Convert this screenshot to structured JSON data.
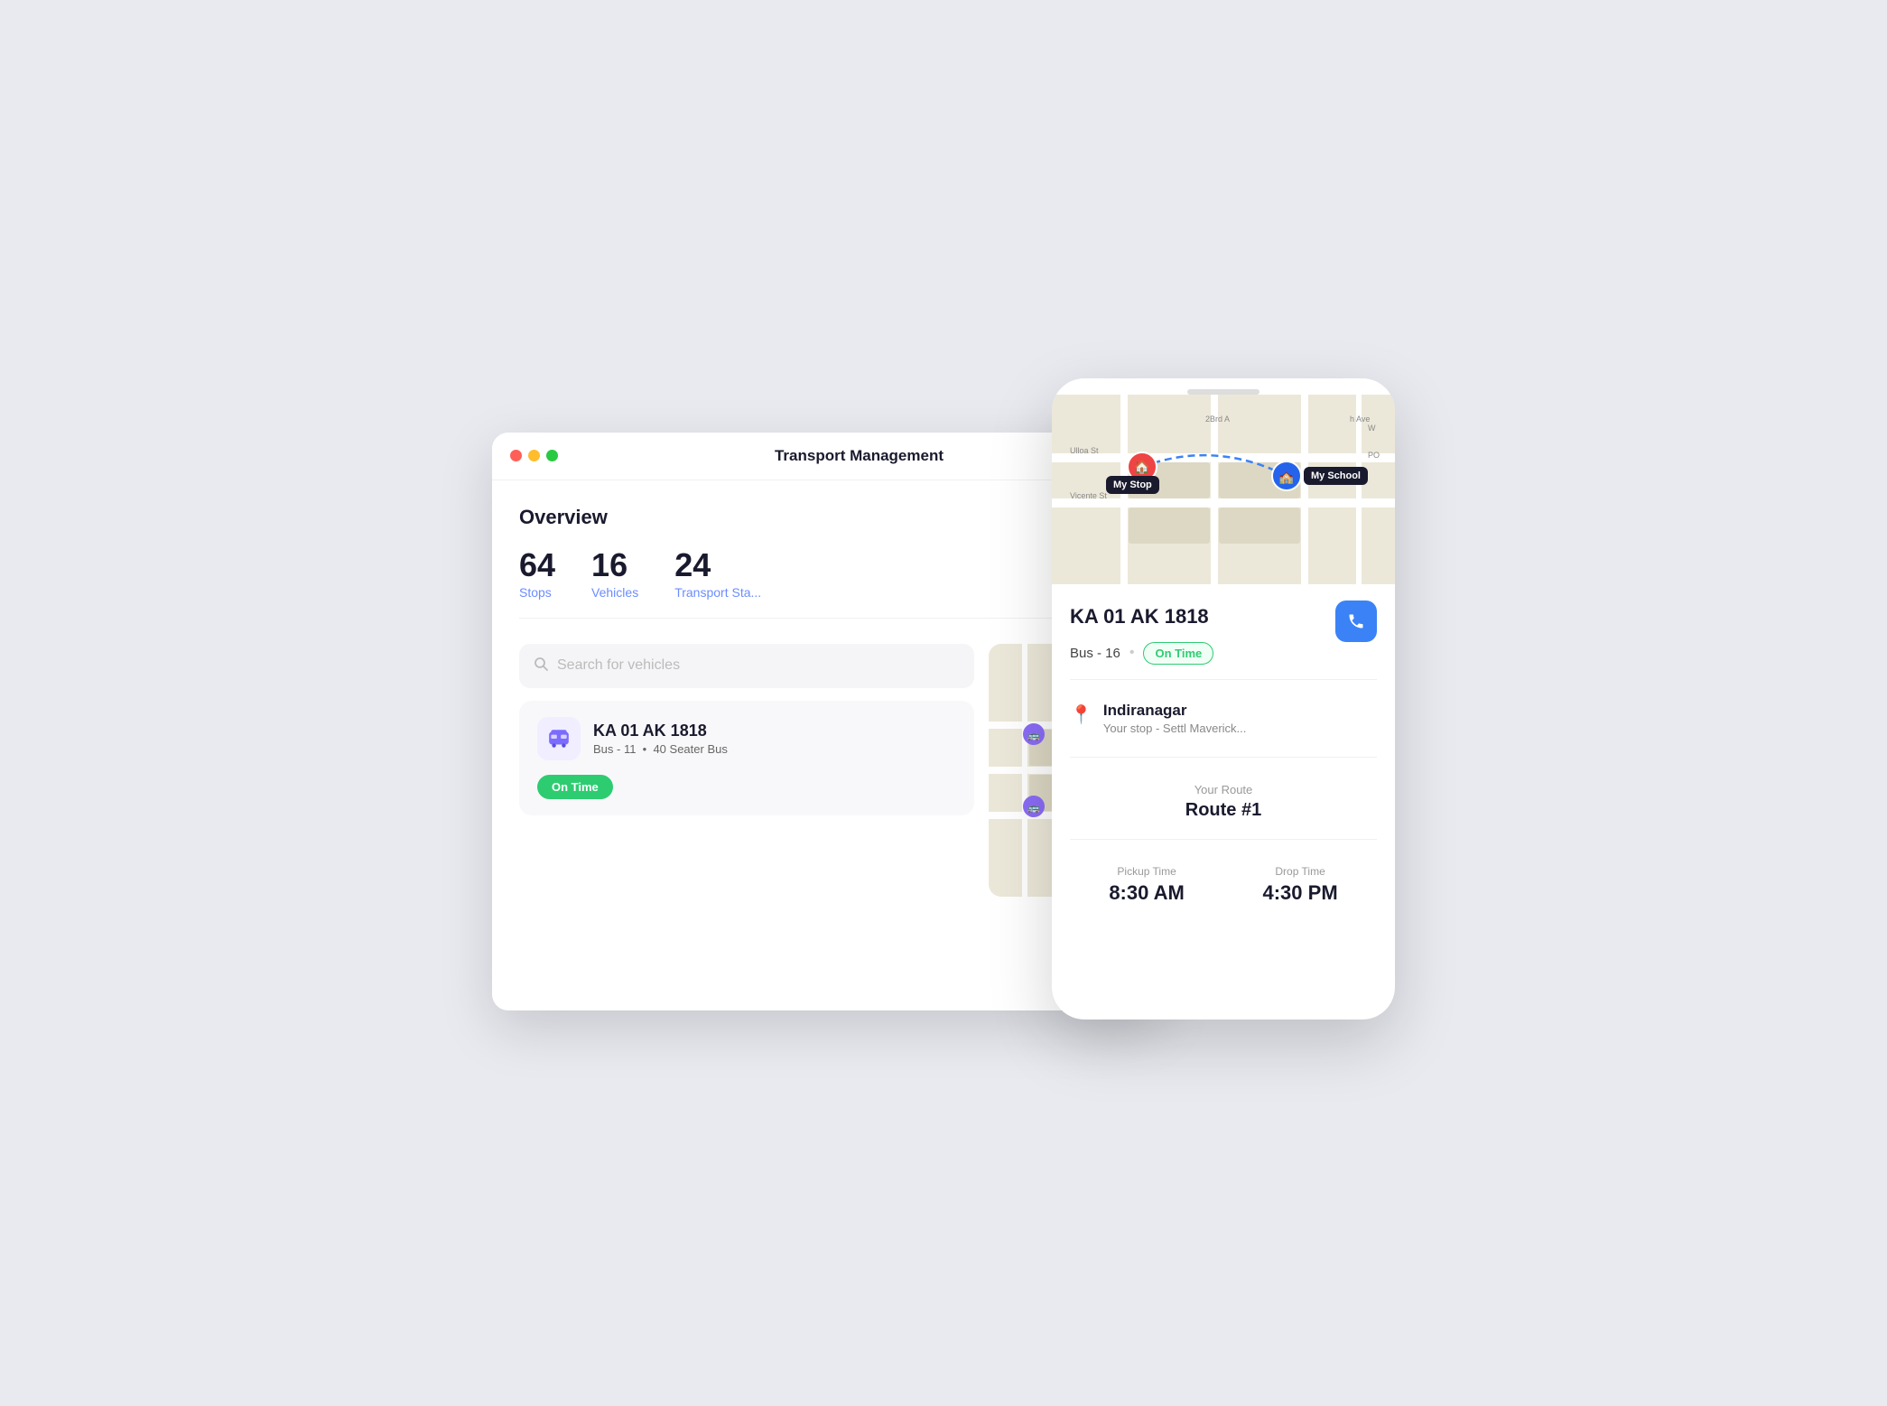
{
  "window": {
    "title": "Transport Management",
    "controls": {
      "red": "close",
      "yellow": "minimize",
      "green": "maximize"
    }
  },
  "overview": {
    "title": "Overview",
    "stats": [
      {
        "number": "64",
        "label": "Stops"
      },
      {
        "number": "16",
        "label": "Vehicles"
      },
      {
        "number": "24",
        "label": "Transport Sta..."
      }
    ]
  },
  "search": {
    "placeholder": "Search for vehicles"
  },
  "vehicle_card": {
    "plate": "KA 01 AK 1818",
    "bus_line": "Bus - 11",
    "seater": "40 Seater Bus",
    "status": "On Time"
  },
  "phone": {
    "map": {
      "my_stop_label": "My Stop",
      "my_school_label": "My School"
    },
    "plate": "KA 01 AK 1818",
    "bus_route": "Bus - 16",
    "status": "On Time",
    "stop": {
      "name": "Indiranagar",
      "sub": "Your stop - Settl Maverick..."
    },
    "route": {
      "label": "Your Route",
      "number": "Route #1"
    },
    "pickup": {
      "label": "Pickup Time",
      "value": "8:30 AM"
    },
    "drop": {
      "label": "Drop Time",
      "value": "4:30 PM"
    }
  }
}
